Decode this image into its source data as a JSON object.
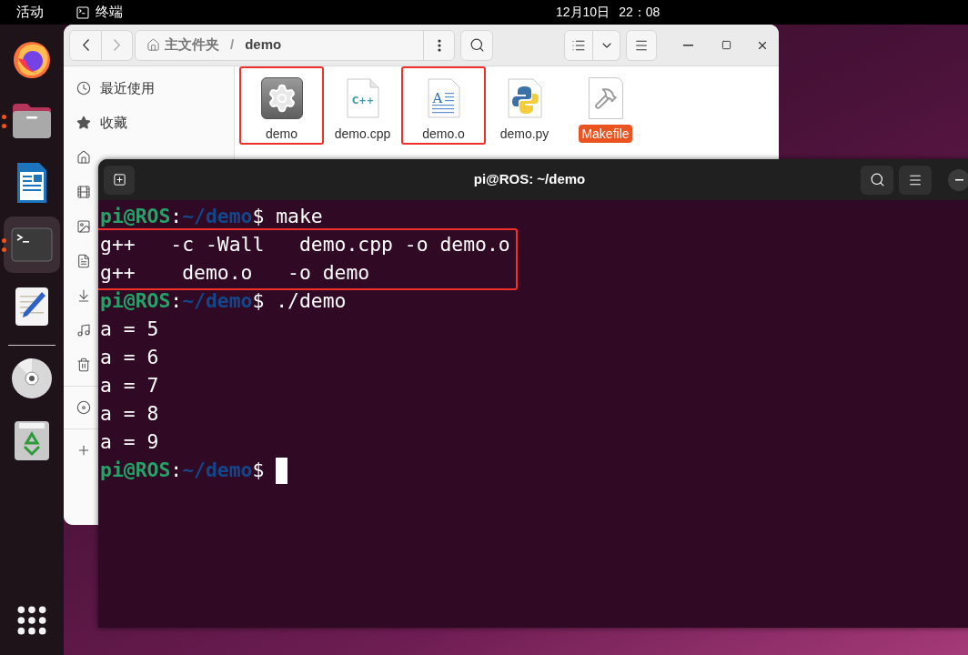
{
  "top_bar": {
    "activities": "活动",
    "app": "终端",
    "date": "12月10日",
    "time": "22：08"
  },
  "dock": {
    "items": [
      {
        "kind": "browser",
        "running": false,
        "selected": false
      },
      {
        "kind": "files",
        "running": true,
        "selected": false
      },
      {
        "kind": "writer",
        "running": false,
        "selected": false
      },
      {
        "kind": "terminal",
        "running": true,
        "selected": true
      },
      {
        "kind": "editor",
        "running": false,
        "selected": false
      },
      {
        "kind": "separator"
      },
      {
        "kind": "disc",
        "running": false,
        "selected": false
      },
      {
        "kind": "trash",
        "running": false,
        "selected": false
      }
    ]
  },
  "files_window": {
    "path": [
      "主文件夹",
      "/",
      "demo"
    ],
    "sidebar": [
      {
        "kind": "recent",
        "label": "最近使用"
      },
      {
        "kind": "starred",
        "label": "收藏"
      },
      {
        "kind": "home"
      },
      {
        "kind": "videos"
      },
      {
        "kind": "pictures"
      },
      {
        "kind": "documents"
      },
      {
        "kind": "downloads"
      },
      {
        "kind": "music"
      },
      {
        "kind": "trash"
      },
      {
        "kind": "separator"
      },
      {
        "kind": "disc"
      },
      {
        "kind": "separator"
      },
      {
        "kind": "add"
      }
    ],
    "files": [
      {
        "name": "demo",
        "kind": "executable",
        "selected": false,
        "highlighted": true
      },
      {
        "name": "demo.cpp",
        "kind": "cpp",
        "icon_text": "C++",
        "selected": false,
        "highlighted": false
      },
      {
        "name": "demo.o",
        "kind": "text",
        "icon_text": "A",
        "selected": false,
        "highlighted": true
      },
      {
        "name": "demo.py",
        "kind": "python",
        "selected": false,
        "highlighted": false
      },
      {
        "name": "Makefile",
        "kind": "makefile",
        "selected": true,
        "highlighted": false
      }
    ]
  },
  "terminal": {
    "title": "pi@ROS: ~/demo",
    "lines": [
      {
        "kind": "prompt",
        "user": "pi@ROS",
        "separator": ":",
        "path": "~/demo",
        "symbol": "$",
        "command": "make"
      },
      {
        "kind": "highlight",
        "lines": [
          {
            "kind": "output",
            "text": "g++   -c -Wall   demo.cpp -o demo.o"
          },
          {
            "kind": "output",
            "text": "g++    demo.o   -o demo"
          }
        ]
      },
      {
        "kind": "prompt",
        "user": "pi@ROS",
        "separator": ":",
        "path": "~/demo",
        "symbol": "$",
        "command": "./demo"
      },
      {
        "kind": "output",
        "text": "a = 5"
      },
      {
        "kind": "output",
        "text": "a = 6"
      },
      {
        "kind": "output",
        "text": "a = 7"
      },
      {
        "kind": "output",
        "text": "a = 8"
      },
      {
        "kind": "output",
        "text": "a = 9"
      },
      {
        "kind": "prompt",
        "user": "pi@ROS",
        "separator": ":",
        "path": "~/demo",
        "symbol": "$"
      }
    ],
    "cursor": true
  }
}
